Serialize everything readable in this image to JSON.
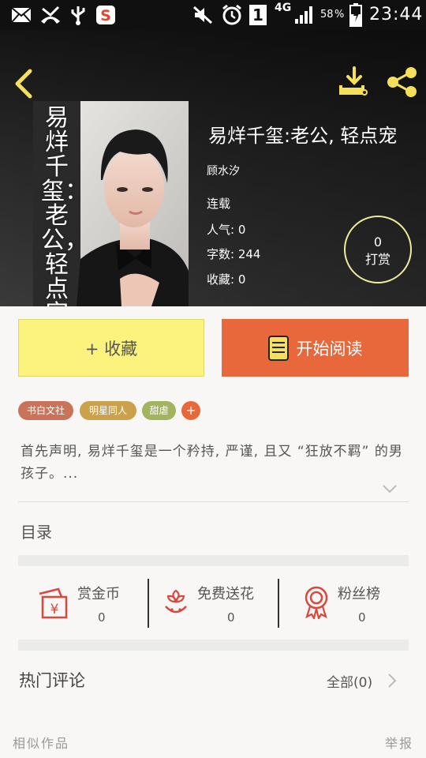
{
  "status_bar": {
    "time": "23:44",
    "battery": "58",
    "network": "4G",
    "sim_slot": "1",
    "icons": [
      "mail-icon",
      "missed-call-icon",
      "usb-icon",
      "weibo-icon",
      "mute-icon",
      "alarm-icon",
      "sim-icon",
      "signal-icon",
      "battery-icon"
    ]
  },
  "header": {
    "back_icon": "chevron-left-icon",
    "download_icon": "download-icon",
    "share_icon": "share-icon"
  },
  "book": {
    "cover_text": "易烊千玺：老公，轻点宠",
    "title": "易烊千玺:老公, 轻点宠",
    "author": "顾水汐",
    "status": "连载",
    "popularity": "人气: 0",
    "word_count": "字数: 244",
    "favorites": "收藏: 0"
  },
  "tip": {
    "count": "0",
    "label": "打赏"
  },
  "actions": {
    "favorite_label": "+ 收藏",
    "read_label": "开始阅读"
  },
  "tags": [
    {
      "label": "书白文社",
      "color": "#c9745a"
    },
    {
      "label": "明星同人",
      "color": "#cba14b"
    },
    {
      "label": "甜虐",
      "color": "#a2b45e"
    },
    {
      "label": "+",
      "color": "#e8673b"
    }
  ],
  "description": "首先声明, 易烊千玺是一个矜持, 严谨, 且又 “狂放不羁” 的男孩子。...",
  "toc": {
    "label": "目录"
  },
  "stats": [
    {
      "label": "赏金币",
      "value": "0",
      "icon": "red-envelope-icon"
    },
    {
      "label": "免费送花",
      "value": "0",
      "icon": "flower-icon"
    },
    {
      "label": "粉丝榜",
      "value": "0",
      "icon": "medal-icon"
    }
  ],
  "comments": {
    "title": "热门评论",
    "all_label": "全部(0)"
  },
  "footer": {
    "similar": "相似作品",
    "report": "举报"
  },
  "colors": {
    "accent_orange": "#e8673b",
    "favorite_yellow": "#fcf37f",
    "icon_yellow": "#f6e05a",
    "icon_red": "#d9483b"
  }
}
